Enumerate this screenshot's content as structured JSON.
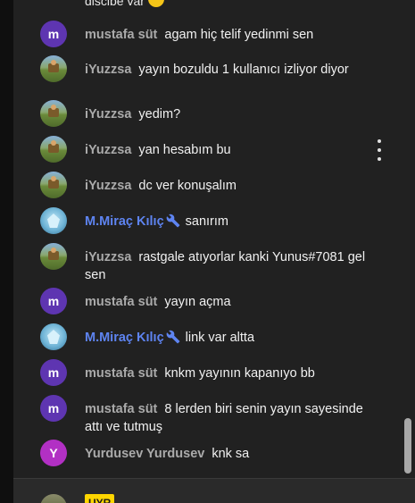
{
  "partial_top_message": {
    "text": "discibe var"
  },
  "messages": [
    {
      "author": "mustafa süt",
      "text": "agam hiç telif yedinmi sen",
      "avatar": "m",
      "avatar_style": "letter",
      "moderator": false
    },
    {
      "author": "iYuzzsa",
      "text": "yayın bozuldu 1 kullanıcı izliyor diyor",
      "avatar": "",
      "avatar_style": "scene",
      "moderator": false
    },
    {
      "author": "iYuzzsa",
      "text": "yedim?",
      "avatar": "",
      "avatar_style": "scene",
      "moderator": false
    },
    {
      "author": "iYuzzsa",
      "text": "yan hesabım bu",
      "avatar": "",
      "avatar_style": "scene",
      "moderator": false
    },
    {
      "author": "iYuzzsa",
      "text": "dc ver konuşalım",
      "avatar": "",
      "avatar_style": "scene",
      "moderator": false
    },
    {
      "author": "M.Miraç Kılıç",
      "text": "sanırım",
      "avatar": "",
      "avatar_style": "skin",
      "moderator": true
    },
    {
      "author": "iYuzzsa",
      "text": "rastgale atıyorlar kanki Yunus#7081 gel sen",
      "avatar": "",
      "avatar_style": "scene",
      "moderator": false
    },
    {
      "author": "mustafa süt",
      "text": "yayın açma",
      "avatar": "m",
      "avatar_style": "letter",
      "moderator": false
    },
    {
      "author": "M.Miraç Kılıç",
      "text": "link var altta",
      "avatar": "",
      "avatar_style": "skin",
      "moderator": true
    },
    {
      "author": "mustafa süt",
      "text": "knkm yayının kapanıyo bb",
      "avatar": "m",
      "avatar_style": "letter",
      "moderator": false
    },
    {
      "author": "mustafa süt",
      "text": "8 lerden biri senin yayın sayesinde attı ve tutmuş",
      "avatar": "m",
      "avatar_style": "letter",
      "moderator": false
    },
    {
      "author": "Yurdusev Yurdusev",
      "text": "knk sa",
      "avatar": "Y",
      "avatar_style": "letter-y",
      "moderator": false
    }
  ],
  "footer": {
    "badge_text": "UYR"
  },
  "icons": {
    "moderator": "wrench-icon",
    "menu": "more-vert-icon"
  },
  "colors": {
    "background": "#212121",
    "moderator_name": "#5e84f1",
    "author_name": "#aaaaaa",
    "badge": "#ffd600"
  }
}
